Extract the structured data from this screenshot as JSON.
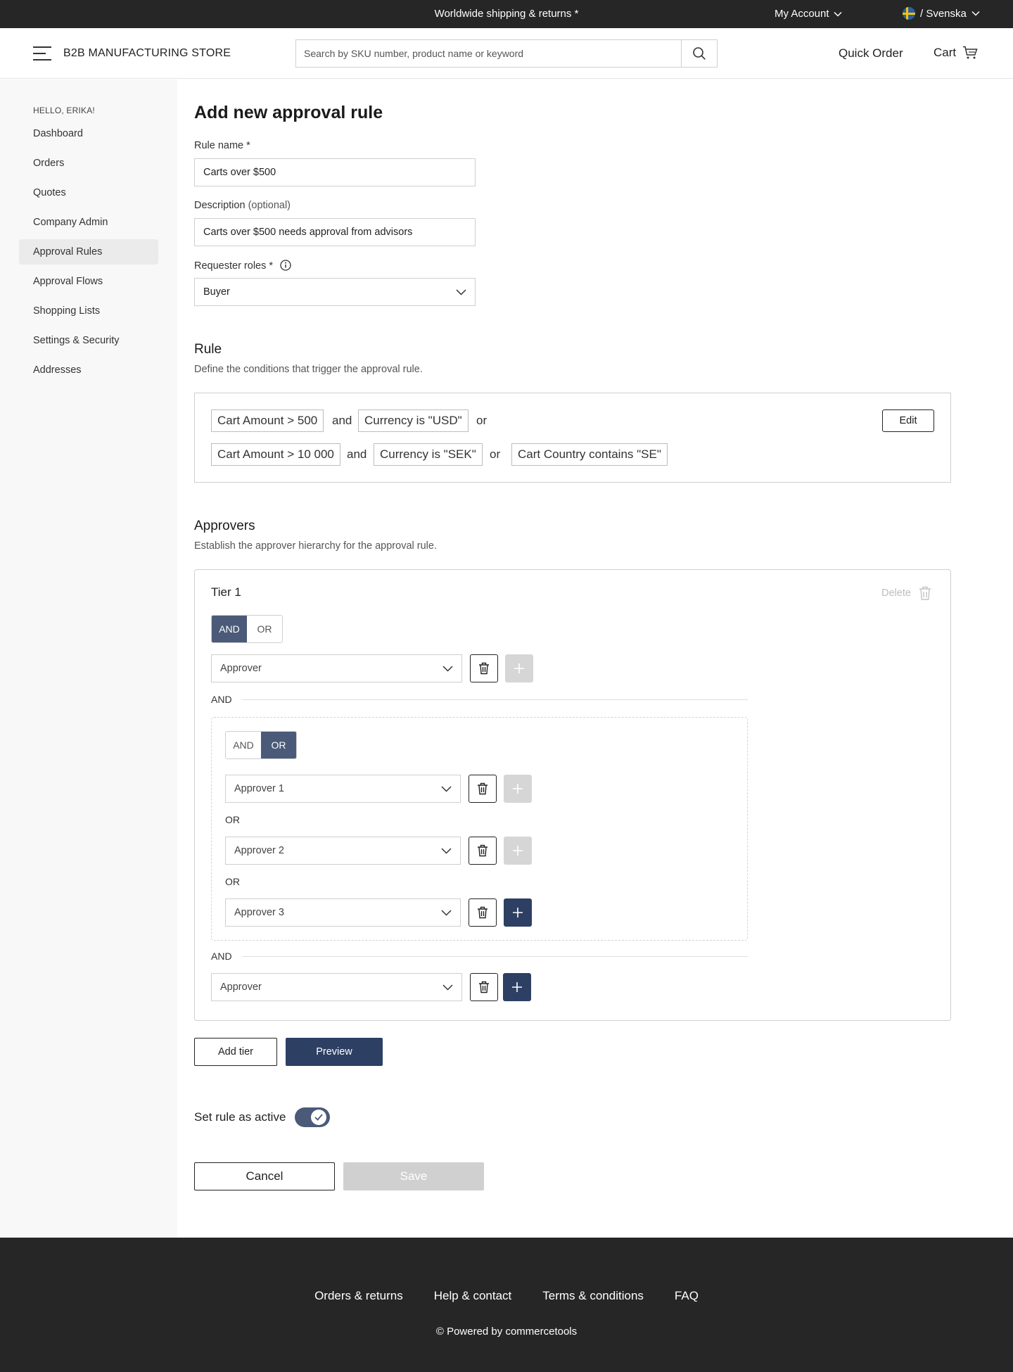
{
  "topbar": {
    "shipping_text": "Worldwide shipping & returns *",
    "my_account": "My Account",
    "language": "/ Svenska"
  },
  "header": {
    "brand": "B2B MANUFACTURING STORE",
    "search_placeholder": "Search by SKU number, product name or keyword",
    "quick_order": "Quick Order",
    "cart": "Cart"
  },
  "sidebar": {
    "greeting": "HELLO, ERIKA!",
    "items": [
      {
        "label": "Dashboard"
      },
      {
        "label": "Orders"
      },
      {
        "label": "Quotes"
      },
      {
        "label": "Company Admin"
      },
      {
        "label": "Approval Rules",
        "active": true
      },
      {
        "label": "Approval Flows"
      },
      {
        "label": "Shopping Lists"
      },
      {
        "label": "Settings & Security"
      },
      {
        "label": "Addresses"
      }
    ]
  },
  "form": {
    "title": "Add new approval rule",
    "rule_name_label": "Rule name *",
    "rule_name_value": "Carts over $500",
    "description_label": "Description",
    "description_optional": "(optional)",
    "description_value": "Carts over $500 needs approval from advisors",
    "requester_label": "Requester roles *",
    "requester_value": "Buyer"
  },
  "rule": {
    "title": "Rule",
    "subtitle": "Define the conditions that trigger the approval rule.",
    "row1": {
      "c1": "Cart Amount > 500",
      "and": "and",
      "c2": "Currency is \"USD\"",
      "or": "or"
    },
    "row2": {
      "c1": "Cart Amount > 10 000",
      "and": "and",
      "c2": "Currency is \"SEK\"",
      "or": "or",
      "c3": "Cart Country contains \"SE\""
    },
    "edit": "Edit"
  },
  "approvers": {
    "title": "Approvers",
    "subtitle": "Establish the approver hierarchy for the approval rule.",
    "tier_title": "Tier 1",
    "delete": "Delete",
    "seg_and": "AND",
    "seg_or": "OR",
    "approver1": "Approver",
    "and_label": "AND",
    "group": {
      "seg_and": "AND",
      "seg_or": "OR",
      "items": [
        "Approver 1",
        "Approver 2",
        "Approver 3"
      ],
      "or_label": "OR"
    },
    "approver_last": "Approver"
  },
  "actions": {
    "add_tier": "Add tier",
    "preview": "Preview",
    "active_label": "Set rule as active",
    "active": true,
    "cancel": "Cancel",
    "save": "Save"
  },
  "footer": {
    "links": [
      "Orders & returns",
      "Help & contact",
      "Terms & conditions",
      "FAQ"
    ],
    "powered": "© Powered by commercetools"
  },
  "colors": {
    "accent": "#2d3f63",
    "segment_on": "#4a5a78",
    "dark_bar": "#262626",
    "sidebar_bg": "#f8f8f8"
  }
}
